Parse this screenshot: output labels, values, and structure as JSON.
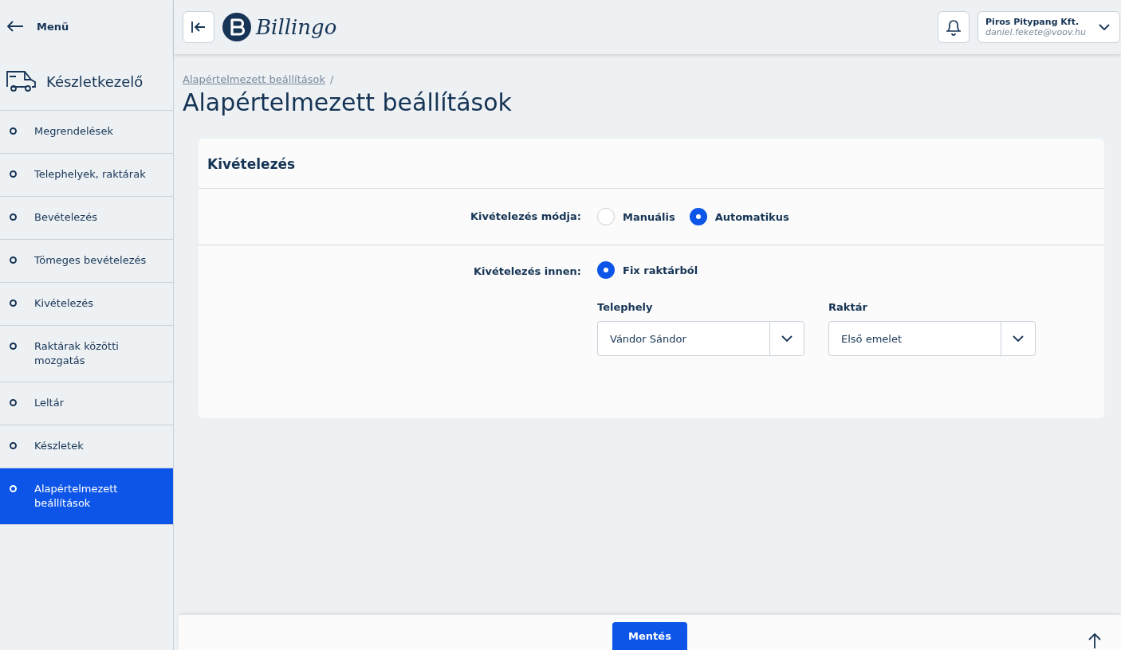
{
  "sidebar": {
    "back_label": "Menü",
    "module_title": "Készletkezelő",
    "items": [
      {
        "label": "Megrendelések",
        "selected": false
      },
      {
        "label": "Telephelyek, raktárak",
        "selected": false
      },
      {
        "label": "Bevételezés",
        "selected": false
      },
      {
        "label": "Tömeges bevételezés",
        "selected": false
      },
      {
        "label": "Kivételezés",
        "selected": false
      },
      {
        "label": "Raktárak közötti mozgatás",
        "selected": false
      },
      {
        "label": "Leltár",
        "selected": false
      },
      {
        "label": "Készletek",
        "selected": false
      },
      {
        "label": "Alapértelmezett beállítások",
        "selected": true
      }
    ]
  },
  "header": {
    "logo_text": "Billingo",
    "account": {
      "company": "Piros Pitypang Kft.",
      "email": "daniel.fekete@voov.hu"
    }
  },
  "breadcrumb": [
    {
      "label": "Alapértelmezett beállítások",
      "separator": "/"
    }
  ],
  "page_title": "Alapértelmezett beállítások",
  "card": {
    "title": "Kivételezés",
    "mode": {
      "label": "Kivételezés módja:",
      "options": [
        {
          "label": "Manuális",
          "selected": false
        },
        {
          "label": "Automatikus",
          "selected": true
        }
      ]
    },
    "source": {
      "label": "Kivételezés innen:",
      "options": [
        {
          "label": "Fix raktárból",
          "selected": true
        }
      ]
    },
    "selects": [
      {
        "label": "Telephely",
        "value": "Vándor Sándor"
      },
      {
        "label": "Raktár",
        "value": "Első emelet"
      }
    ]
  },
  "footer": {
    "save_button": "Mentés"
  }
}
